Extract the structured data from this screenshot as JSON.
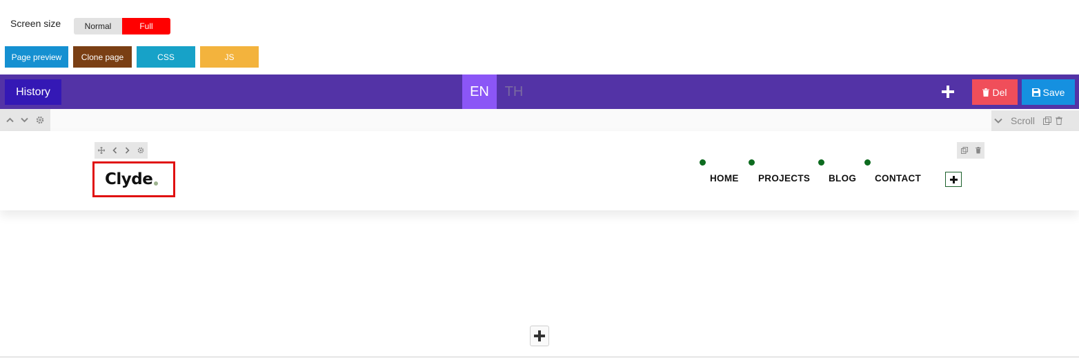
{
  "controls": {
    "screen_size_label": "Screen size",
    "normal_label": "Normal",
    "full_label": "Full"
  },
  "toolbar": {
    "page_preview": "Page preview",
    "clone_page": "Clone page",
    "css": "CSS",
    "js": "JS"
  },
  "editor_bar": {
    "history": "History",
    "lang_en": "EN",
    "lang_th": "TH",
    "del": "Del",
    "save": "Save"
  },
  "section_toolbar": {
    "scroll_label": "Scroll"
  },
  "site_header": {
    "logo_text": "Clyde",
    "nav": [
      {
        "label": "HOME"
      },
      {
        "label": "PROJECTS"
      },
      {
        "label": "BLOG"
      },
      {
        "label": "CONTACT"
      }
    ]
  },
  "colors": {
    "purple_bar": "#5333a6",
    "history_bg": "#3418b5",
    "en_active": "#8b56f6",
    "full_active": "#ff0000",
    "del_bg": "#f04e5a",
    "save_bg": "#1590e0",
    "nav_dot": "#0d6b1f",
    "logo_outline": "#e01010"
  }
}
